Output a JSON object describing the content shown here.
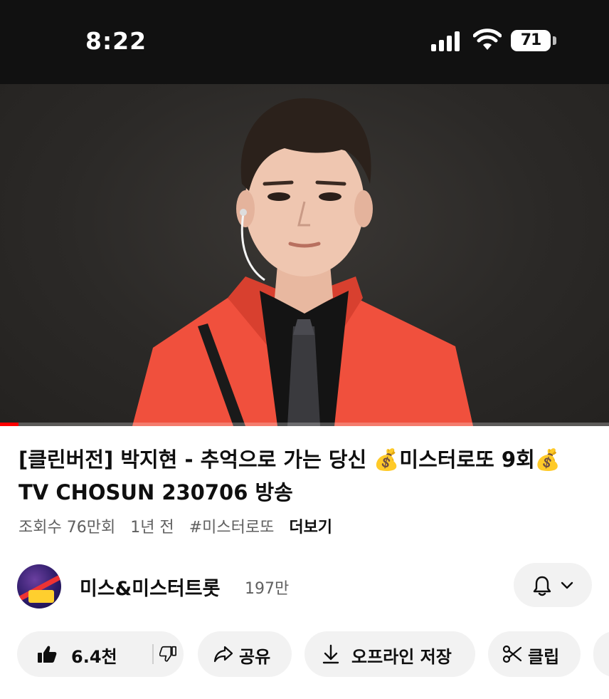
{
  "status_bar": {
    "time": "8:22",
    "battery": "71"
  },
  "video": {
    "progress": 0.03,
    "progress_color": "#ff0000"
  },
  "title": "[클린버전] 박지현 - 추억으로 가는 당신 💰미스터로또 9회💰 TV CHOSUN 230706 방송",
  "meta": {
    "views": "조회수 76만회",
    "age": "1년 전",
    "hashtag": "#미스터로또",
    "more": "더보기"
  },
  "channel": {
    "name": "미스&미스터트롯",
    "subscribers": "197만"
  },
  "actions": {
    "likes": "6.4천",
    "share": "공유",
    "download": "오프라인 저장",
    "clip": "클립"
  }
}
